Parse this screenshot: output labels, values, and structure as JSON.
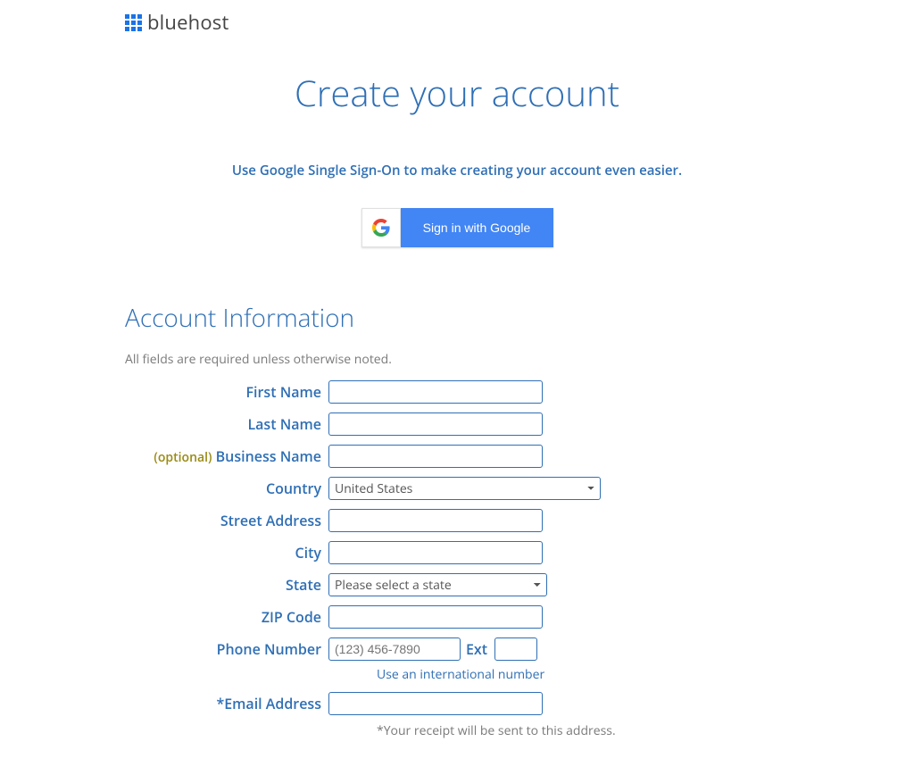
{
  "brand": "bluehost",
  "heading": "Create your account",
  "sso": {
    "blurb": "Use Google Single Sign-On to make creating your account even easier.",
    "button": "Sign in with Google"
  },
  "section_title": "Account Information",
  "required_note": "All fields are required unless otherwise noted.",
  "optional_tag": "(optional)",
  "labels": {
    "first_name": "First Name",
    "last_name": "Last Name",
    "business_name": "Business Name",
    "country": "Country",
    "street_address": "Street Address",
    "city": "City",
    "state": "State",
    "zip": "ZIP Code",
    "phone": "Phone Number",
    "ext": "Ext",
    "email": "*Email Address"
  },
  "values": {
    "first_name": "",
    "last_name": "",
    "business_name": "",
    "country_selected": "United States",
    "street_address": "",
    "city": "",
    "state_selected": "Please select a state",
    "zip": "",
    "phone": "",
    "ext": "",
    "email": ""
  },
  "placeholders": {
    "phone": "(123) 456-7890"
  },
  "intl_link": "Use an international number",
  "receipt_note": "*Your receipt will be sent to this address."
}
